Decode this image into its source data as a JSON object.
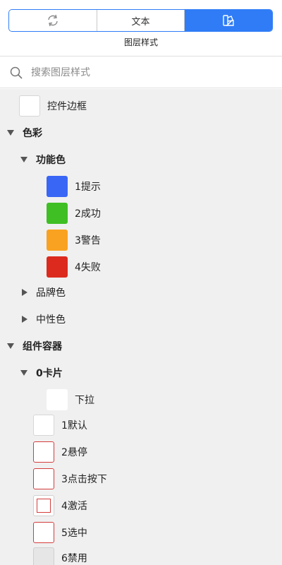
{
  "segmented": {
    "tabs": [
      {
        "icon": "refresh-icon",
        "label": ""
      },
      {
        "icon": "",
        "label": "文本"
      },
      {
        "icon": "color-swatch-icon",
        "label": "",
        "active": true
      }
    ]
  },
  "panel_title": "图层样式",
  "search": {
    "placeholder": "搜索图层样式",
    "value": ""
  },
  "tree": {
    "control_border": "控件边框",
    "color_group": "色彩",
    "functional_color": "功能色",
    "functional_items": [
      {
        "label": "1提示",
        "color": "#3a66f5"
      },
      {
        "label": "2成功",
        "color": "#3fbf24"
      },
      {
        "label": "3警告",
        "color": "#f9a221"
      },
      {
        "label": "4失败",
        "color": "#dc2a1f"
      }
    ],
    "brand_color": "品牌色",
    "neutral_color": "中性色",
    "component_container": "组件容器",
    "card_group": "0卡片",
    "dropdown": "下拉",
    "states": [
      "1默认",
      "2悬停",
      "3点击按下",
      "4激活",
      "5选中",
      "6禁用"
    ]
  }
}
